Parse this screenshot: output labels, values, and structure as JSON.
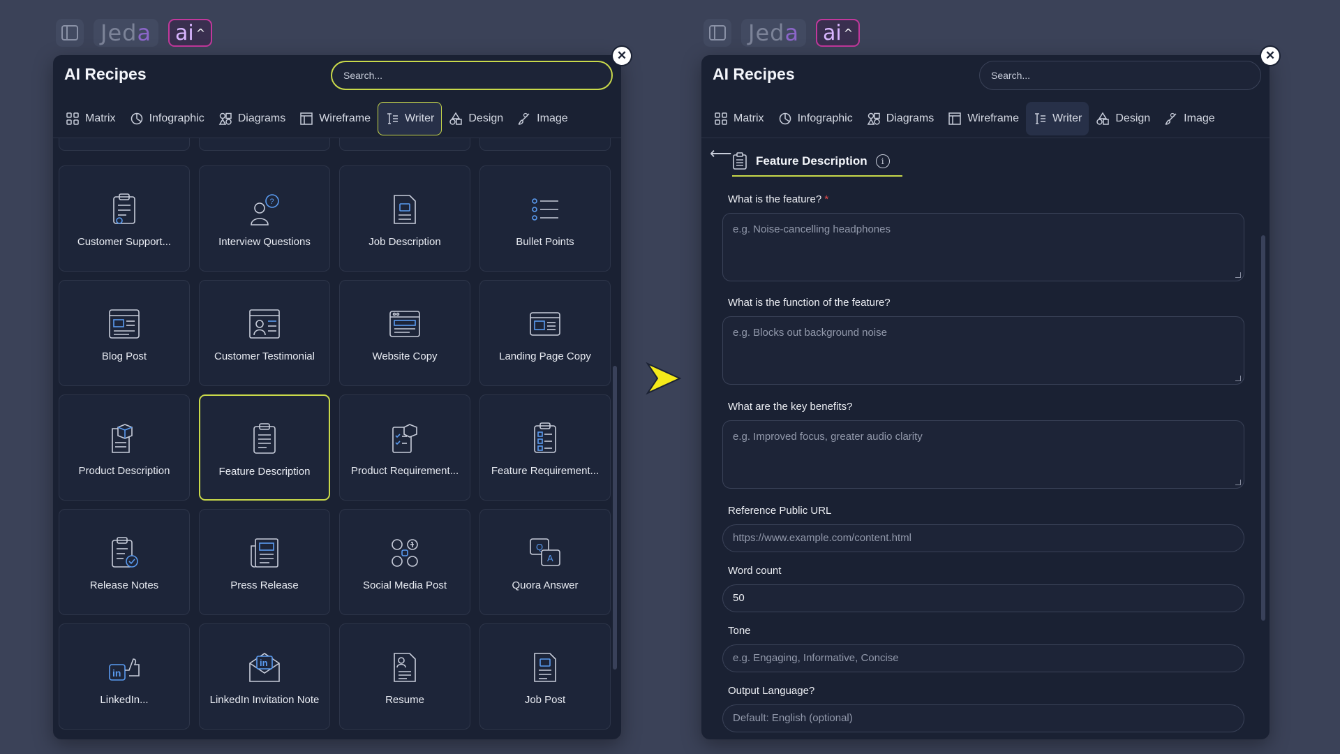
{
  "toolbar": {
    "logo": "Jeda",
    "ai_label": "ai",
    "ai_chevron": "^"
  },
  "panel_title": "AI Recipes",
  "search_placeholder": "Search...",
  "tabs": [
    {
      "label": "Matrix",
      "icon": "grid-icon"
    },
    {
      "label": "Infographic",
      "icon": "pie-icon"
    },
    {
      "label": "Diagrams",
      "icon": "shapes-icon"
    },
    {
      "label": "Wireframe",
      "icon": "wireframe-icon"
    },
    {
      "label": "Writer",
      "icon": "text-icon"
    },
    {
      "label": "Design",
      "icon": "design-icon"
    },
    {
      "label": "Image",
      "icon": "brush-icon"
    }
  ],
  "active_tab": "Writer",
  "recipes": [
    {
      "label": "Customer Support...",
      "icon": "clipboard-icon"
    },
    {
      "label": "Interview Questions",
      "icon": "person-question-icon"
    },
    {
      "label": "Job Description",
      "icon": "briefcase-doc-icon"
    },
    {
      "label": "Bullet Points",
      "icon": "list-icon"
    },
    {
      "label": "Blog Post",
      "icon": "browser-article-icon"
    },
    {
      "label": "Customer Testimonial",
      "icon": "testimonial-icon"
    },
    {
      "label": "Website Copy",
      "icon": "website-icon"
    },
    {
      "label": "Landing Page Copy",
      "icon": "landing-page-icon"
    },
    {
      "label": "Product Description",
      "icon": "box-doc-icon"
    },
    {
      "label": "Feature Description",
      "icon": "clipboard-lines-icon"
    },
    {
      "label": "Product Requirement...",
      "icon": "box-checklist-icon"
    },
    {
      "label": "Feature Requirement...",
      "icon": "clipboard-checklist-icon"
    },
    {
      "label": "Release Notes",
      "icon": "release-notes-icon"
    },
    {
      "label": "Press Release",
      "icon": "newspaper-icon"
    },
    {
      "label": "Social Media Post",
      "icon": "social-icon"
    },
    {
      "label": "Quora Answer",
      "icon": "chat-qa-icon"
    },
    {
      "label": "LinkedIn...",
      "icon": "linkedin-like-icon"
    },
    {
      "label": "LinkedIn Invitation Note",
      "icon": "linkedin-envelope-icon"
    },
    {
      "label": "Resume",
      "icon": "resume-icon"
    },
    {
      "label": "Job Post",
      "icon": "job-post-icon"
    }
  ],
  "selected_recipe": "Feature Description",
  "form": {
    "title": "Feature Description",
    "fields": [
      {
        "label": "What is the feature?",
        "required": true,
        "placeholder": "e.g. Noise-cancelling headphones",
        "multiline": true
      },
      {
        "label": "What is the function of the feature?",
        "placeholder": "e.g. Blocks out background noise",
        "multiline": true
      },
      {
        "label": "What are the key benefits?",
        "placeholder": "e.g. Improved focus, greater audio clarity",
        "multiline": true
      },
      {
        "label": "Reference Public URL",
        "placeholder": "https://www.example.com/content.html"
      },
      {
        "label": "Word count",
        "value": "50"
      },
      {
        "label": "Tone",
        "placeholder": "e.g. Engaging, Informative, Concise"
      },
      {
        "label": "Output Language?",
        "placeholder": "Default: English (optional)"
      }
    ]
  },
  "colors": {
    "accent": "#c9d94a",
    "panel": "#1a2133",
    "background": "#3b4258",
    "arrow": "#f5ea1a"
  }
}
